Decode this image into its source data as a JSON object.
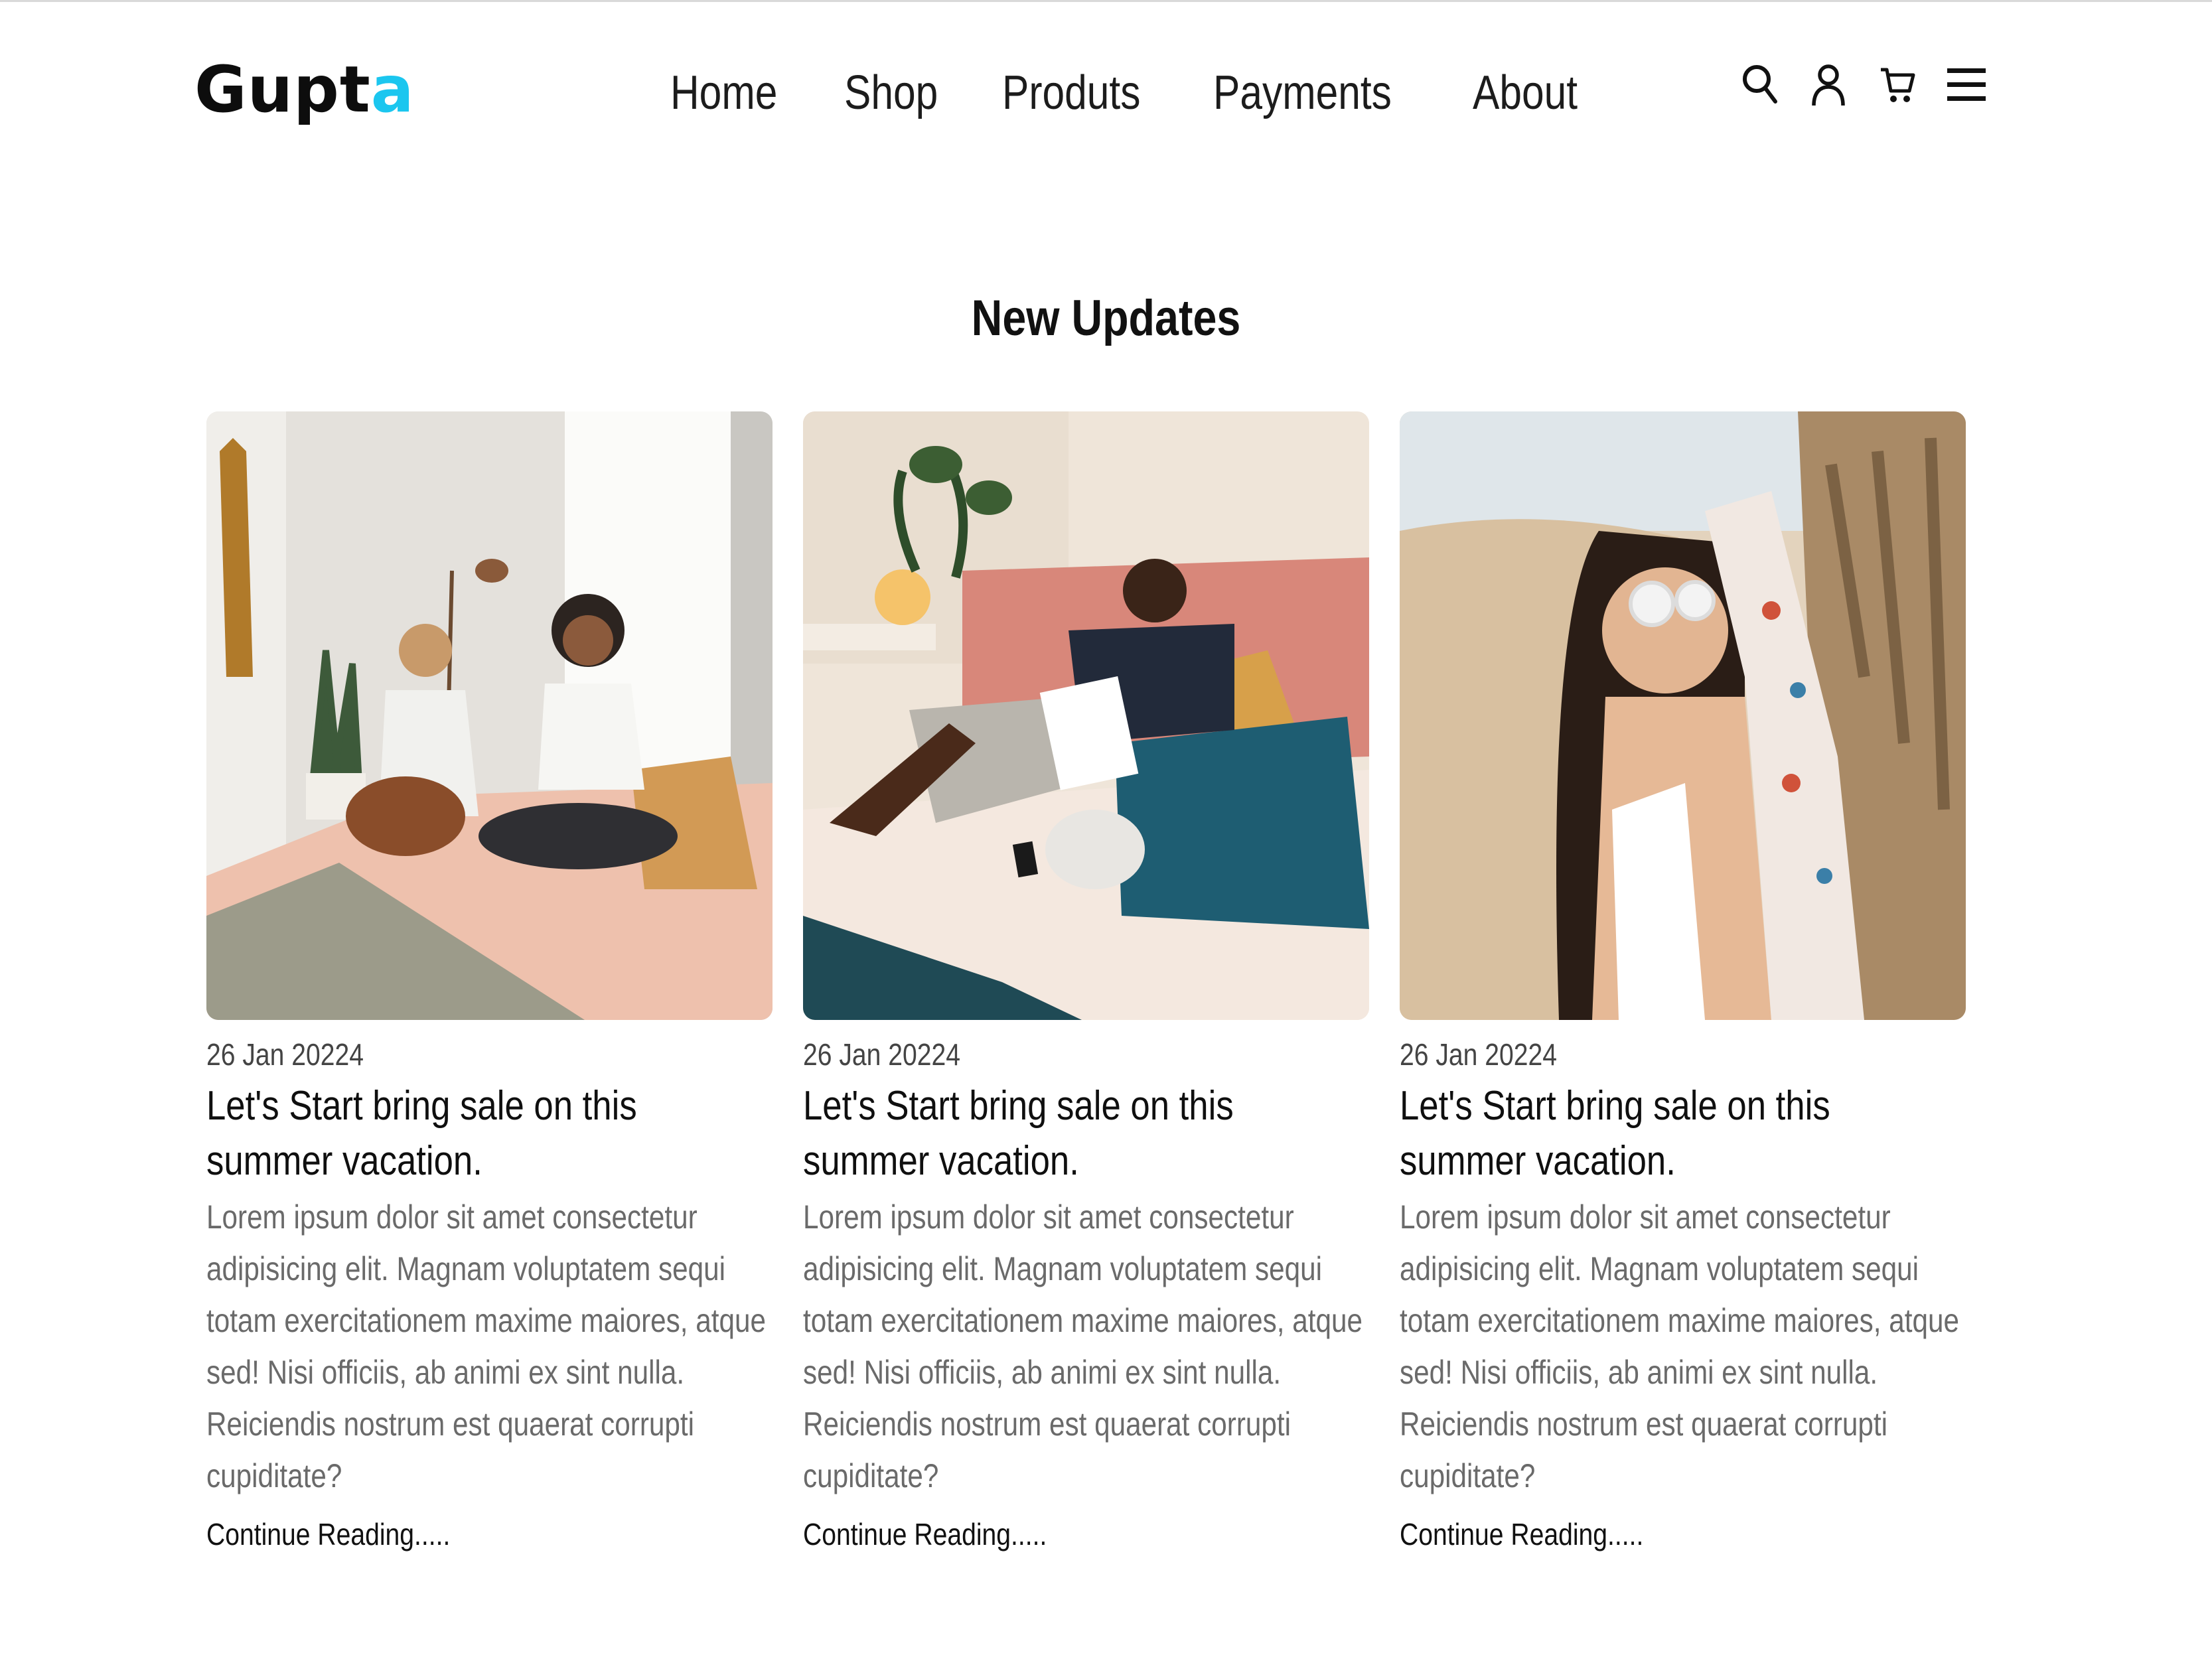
{
  "brand": {
    "logo_main": "Gupt",
    "logo_accent": "a",
    "accent_color": "#1bc6ef"
  },
  "nav": [
    {
      "label": "Home"
    },
    {
      "label": "Shop"
    },
    {
      "label": "Produts"
    },
    {
      "label": "Payments"
    },
    {
      "label": "About"
    }
  ],
  "header_icons": [
    "search-icon",
    "user-icon",
    "cart-icon",
    "menu-icon"
  ],
  "section": {
    "title": "New Updates"
  },
  "posts": [
    {
      "image": "photo of two women with a dog on a bed",
      "date": "26 Jan 20224",
      "title": "Let's Start bring sale on this summer vacation.",
      "body": "Lorem ipsum dolor sit amet consectetur adipisicing elit. Magnam voluptatem sequi totam exercitationem maxime maiores, atque sed! Nisi officiis, ab animi ex sint nulla. Reiciendis nostrum est quaerat corrupti cupiditate?",
      "link": "Continue Reading....."
    },
    {
      "image": "photo of a man reading a book on a bed",
      "date": "26 Jan 20224",
      "title": "Let's Start bring sale on this summer vacation.",
      "body": "Lorem ipsum dolor sit amet consectetur adipisicing elit. Magnam voluptatem sequi totam exercitationem maxime maiores, atque sed! Nisi officiis, ab animi ex sint nulla. Reiciendis nostrum est quaerat corrupti cupiditate?",
      "link": "Continue Reading....."
    },
    {
      "image": "photo of a woman in sunglasses on a beach",
      "date": "26 Jan 20224",
      "title": "Let's Start bring sale on this summer vacation.",
      "body": "Lorem ipsum dolor sit amet consectetur adipisicing elit. Magnam voluptatem sequi totam exercitationem maxime maiores, atque sed! Nisi officiis, ab animi ex sint nulla. Reiciendis nostrum est quaerat corrupti cupiditate?",
      "link": "Continue Reading....."
    }
  ]
}
